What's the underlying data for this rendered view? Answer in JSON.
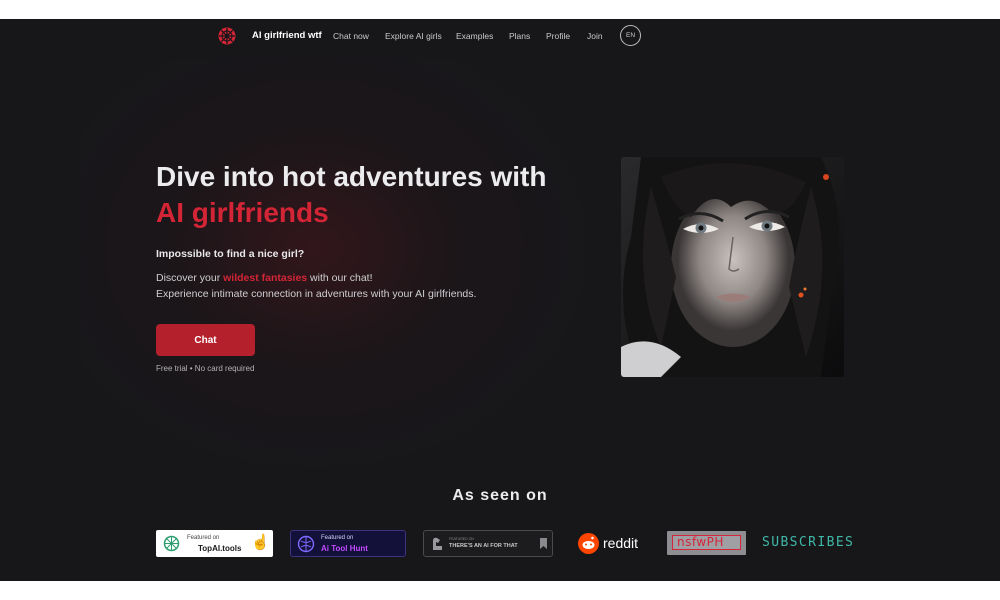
{
  "nav": {
    "brand": "AI girlfriend wtf",
    "links": [
      "Chat now",
      "Explore AI girls",
      "Examples",
      "Plans",
      "Profile",
      "Join"
    ],
    "language": "EN"
  },
  "hero": {
    "title_main": "Dive into hot adventures with ",
    "title_accent": "AI girlfriends",
    "subheading": "Impossible to find a nice girl?",
    "desc_prefix": "Discover your ",
    "desc_highlight": "wildest fantasies",
    "desc_suffix": " with our chat!",
    "desc_line2": "Experience intimate connection in adventures with your AI girlfriends.",
    "cta_label": "Chat",
    "cta_note": "Free trial • No card required"
  },
  "seen_on": {
    "title": "As seen on",
    "badges": {
      "topai_small": "Featured on",
      "topai_name": "TopAI.tools",
      "hunt_small": "Featured on",
      "hunt_name": "Ai Tool Hunt",
      "aithat_small": "FEATURED ON",
      "aithat_name": "THERE'S AN AI FOR THAT",
      "reddit": "reddit",
      "nsfwph": "nsfwPH",
      "subscribes": "SUBSCRIBES"
    }
  },
  "colors": {
    "background": "#17171a",
    "accent": "#d32536",
    "button": "#b5202d"
  }
}
